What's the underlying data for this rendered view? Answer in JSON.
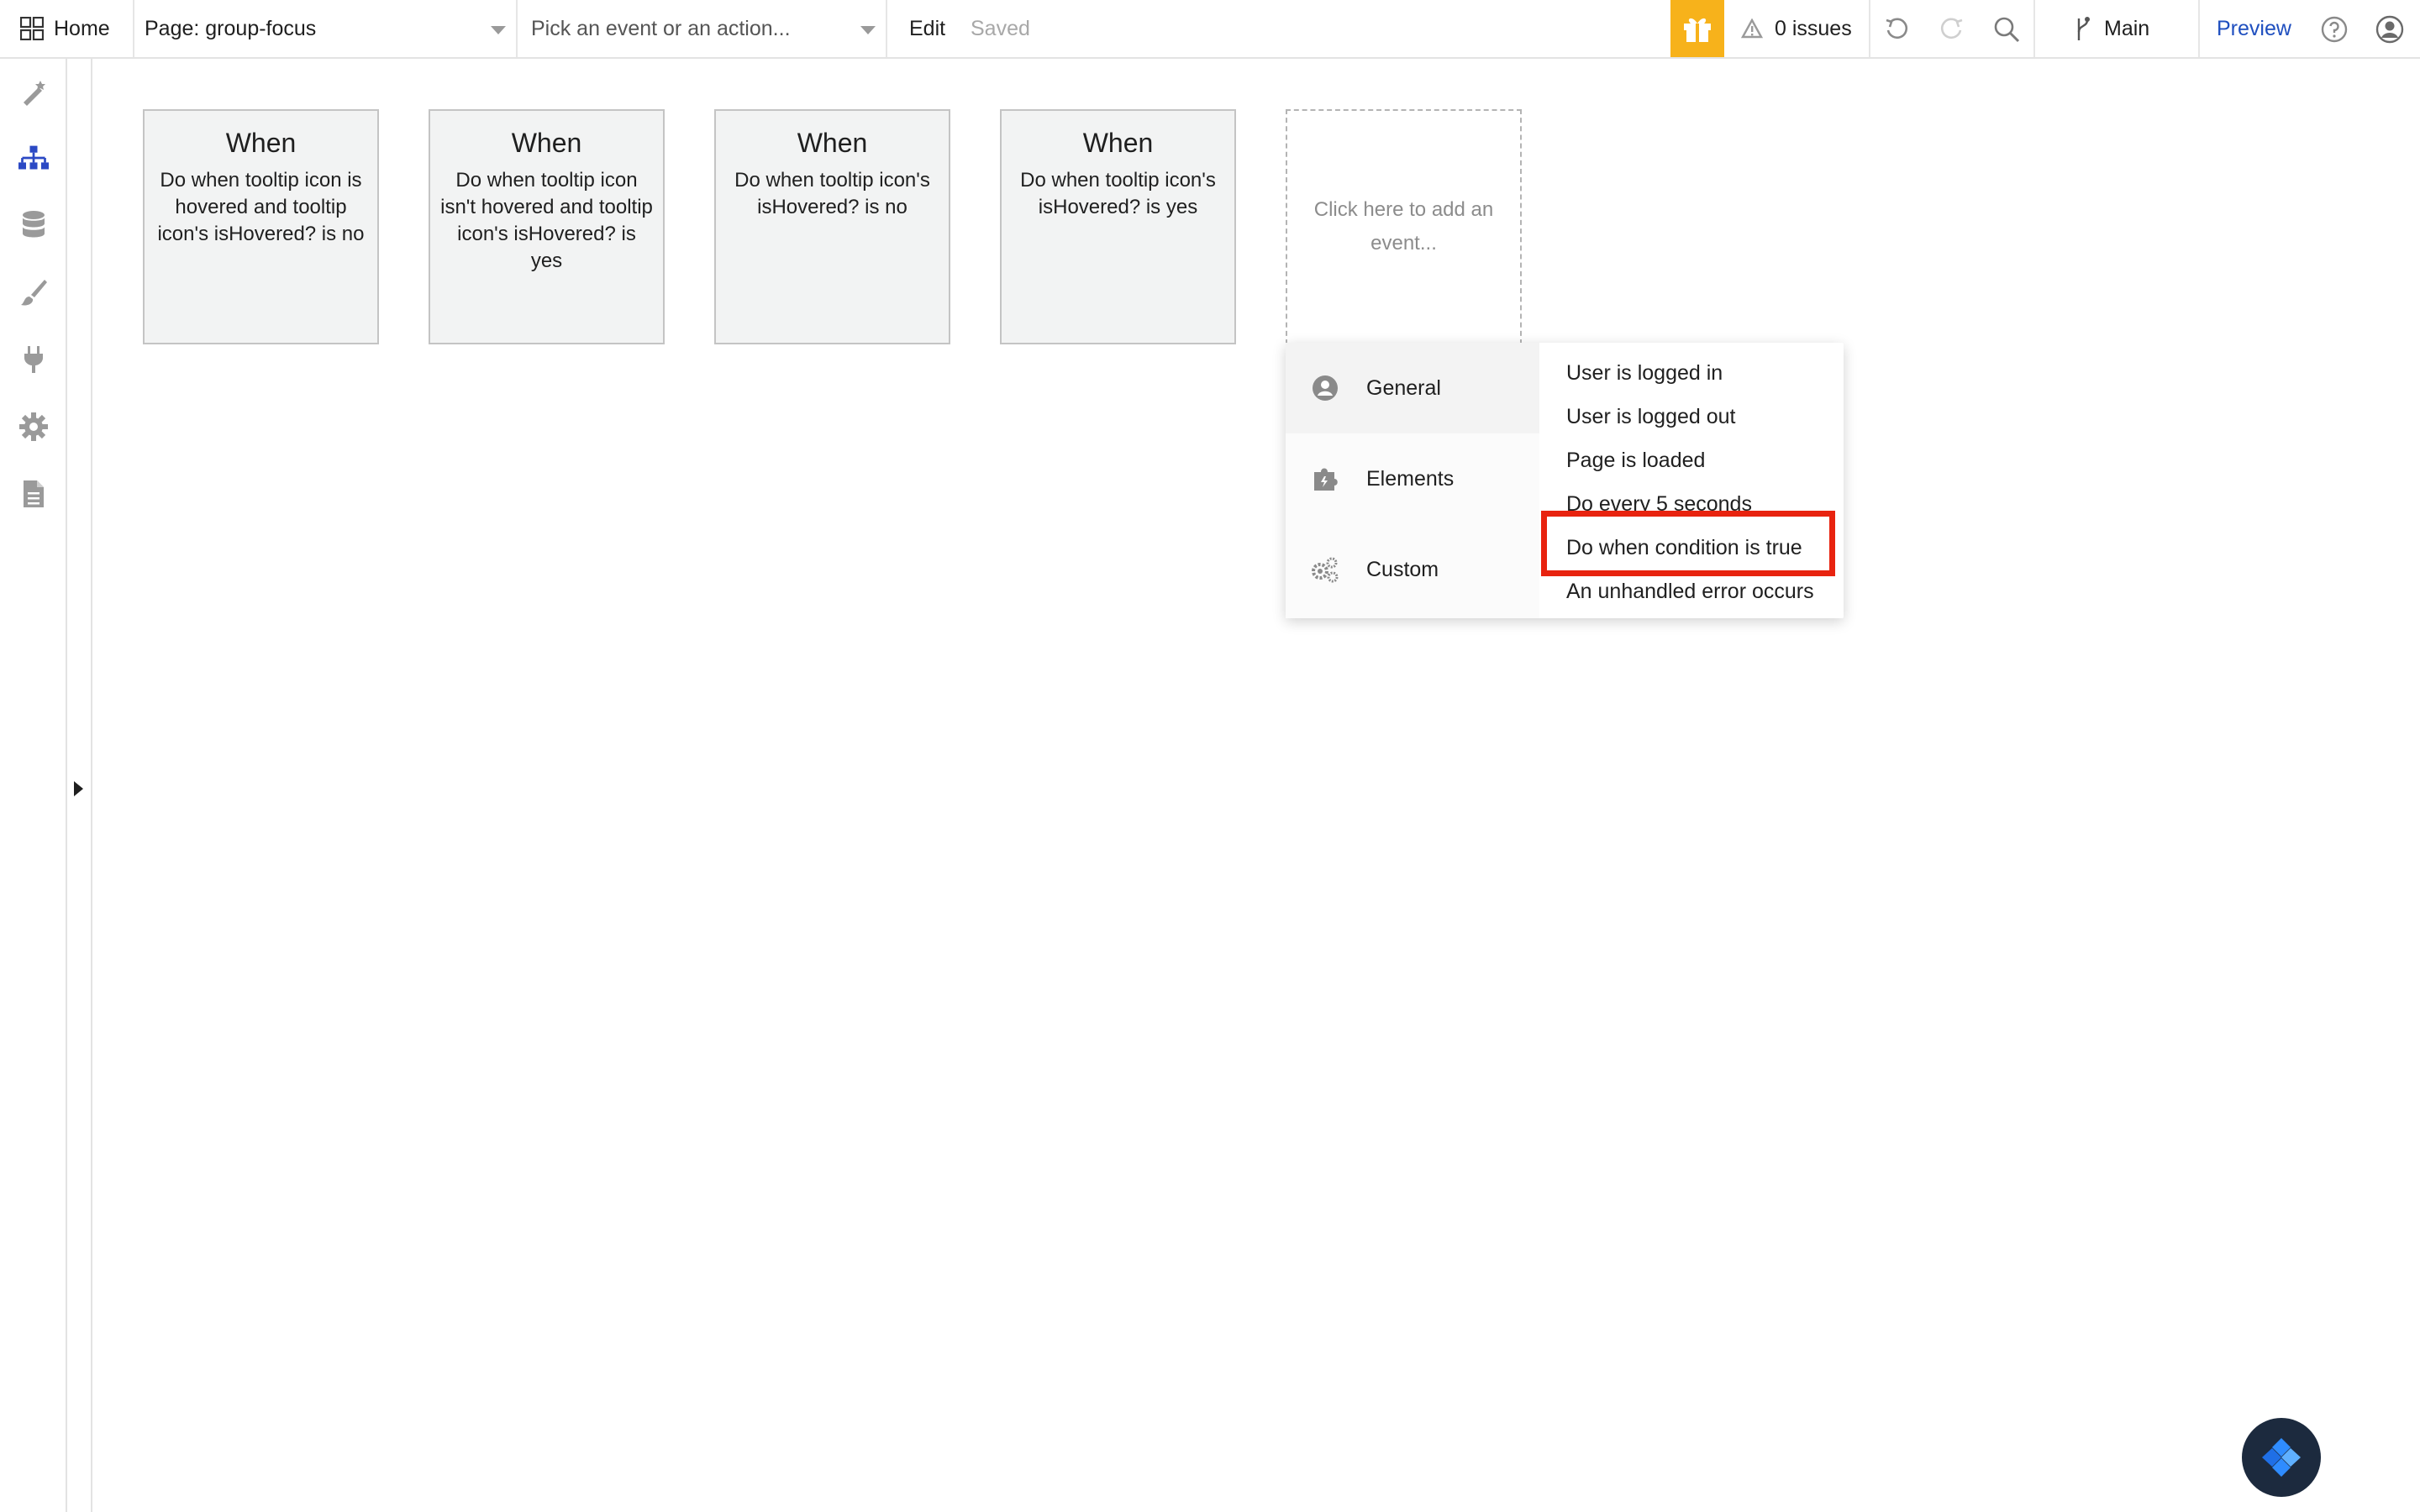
{
  "topbar": {
    "home_label": "Home",
    "page_select": "Page: group-focus",
    "event_select_placeholder": "Pick an event or an action...",
    "edit_label": "Edit",
    "saved_label": "Saved",
    "issues_label": "0 issues",
    "branch_label": "Main",
    "preview_label": "Preview"
  },
  "sidebar": {
    "items": [
      "design-icon",
      "workflow-icon",
      "data-icon",
      "styles-icon",
      "plugins-icon",
      "settings-icon",
      "logs-icon"
    ],
    "active_color": "#2b49c4"
  },
  "cards": [
    {
      "title": "When",
      "desc": "Do when tooltip icon is hovered and tooltip icon's isHovered? is no"
    },
    {
      "title": "When",
      "desc": "Do when tooltip icon isn't hovered and tooltip icon's isHovered? is yes"
    },
    {
      "title": "When",
      "desc": "Do when tooltip icon's isHovered? is no"
    },
    {
      "title": "When",
      "desc": "Do when tooltip icon's isHovered? is yes"
    }
  ],
  "add_event": "Click here to add an event...",
  "dropdown": {
    "categories": [
      "General",
      "Elements",
      "Custom"
    ],
    "options": [
      "User is logged in",
      "User is logged out",
      "Page is loaded",
      "Do every 5 seconds",
      "Do when condition is true",
      "An unhandled error occurs"
    ]
  },
  "colors": {
    "accent": "#f7b21b",
    "highlight": "#e8230f",
    "link": "#1f4fbf"
  }
}
